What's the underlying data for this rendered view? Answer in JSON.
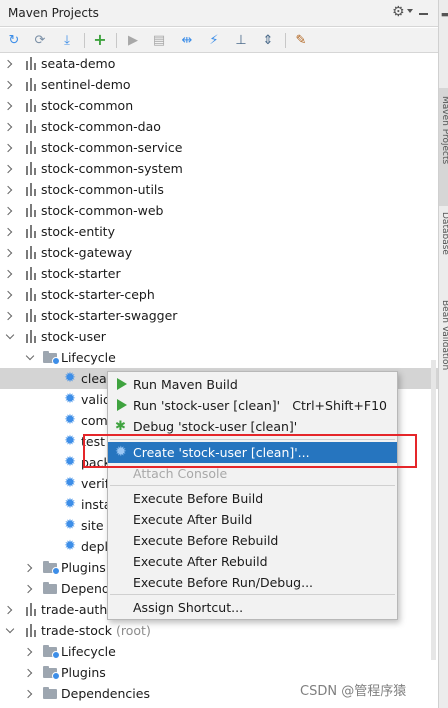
{
  "panel": {
    "title": "Maven Projects"
  },
  "toolbar": {
    "icons": [
      "refresh-icon",
      "reimport-icon",
      "download-icon",
      "add-icon",
      "run-icon",
      "execute-goal-icon",
      "toggle-offline-icon",
      "skip-tests-icon",
      "show-dependencies-icon",
      "collapse-all-icon",
      "settings-icon"
    ]
  },
  "tree": {
    "rows": [
      {
        "label": "seata-demo"
      },
      {
        "label": "sentinel-demo"
      },
      {
        "label": "stock-common"
      },
      {
        "label": "stock-common-dao"
      },
      {
        "label": "stock-common-service"
      },
      {
        "label": "stock-common-system"
      },
      {
        "label": "stock-common-utils"
      },
      {
        "label": "stock-common-web"
      },
      {
        "label": "stock-entity"
      },
      {
        "label": "stock-gateway"
      },
      {
        "label": "stock-starter"
      },
      {
        "label": "stock-starter-ceph"
      },
      {
        "label": "stock-starter-swagger"
      },
      {
        "label": "stock-user"
      },
      {
        "label": "Lifecycle"
      },
      {
        "label": "clean"
      },
      {
        "label": "validate"
      },
      {
        "label": "compile"
      },
      {
        "label": "test"
      },
      {
        "label": "package"
      },
      {
        "label": "verify"
      },
      {
        "label": "install"
      },
      {
        "label": "site"
      },
      {
        "label": "deploy"
      },
      {
        "label": "Plugins"
      },
      {
        "label": "Dependencies"
      },
      {
        "label": "trade-auth"
      },
      {
        "label": "trade-stock",
        "suffix": "(root)"
      },
      {
        "label": "Lifecycle"
      },
      {
        "label": "Plugins"
      },
      {
        "label": "Dependencies"
      }
    ]
  },
  "context_menu": {
    "items": [
      {
        "label": "Run Maven Build",
        "shortcut": ""
      },
      {
        "label": "Run 'stock-user [clean]'",
        "shortcut": "Ctrl+Shift+F10"
      },
      {
        "label": "Debug 'stock-user [clean]'",
        "shortcut": ""
      },
      {
        "label": "Create 'stock-user [clean]'...",
        "shortcut": ""
      },
      {
        "label": "Attach Console",
        "shortcut": ""
      },
      {
        "label": "Execute Before Build",
        "shortcut": ""
      },
      {
        "label": "Execute After Build",
        "shortcut": ""
      },
      {
        "label": "Execute Before Rebuild",
        "shortcut": ""
      },
      {
        "label": "Execute After Rebuild",
        "shortcut": ""
      },
      {
        "label": "Execute Before Run/Debug...",
        "shortcut": ""
      },
      {
        "label": "Assign Shortcut...",
        "shortcut": ""
      }
    ]
  },
  "side_tabs": {
    "tab1": "Maven Projects",
    "tab2": "Database",
    "tab3": "Bean Validation"
  },
  "watermark": "CSDN @管程序猿",
  "colors": {
    "highlight": "#2675bf",
    "red_box": "#e5262a",
    "run_green": "#3fa33f",
    "goal_blue": "#3d8ee8"
  }
}
